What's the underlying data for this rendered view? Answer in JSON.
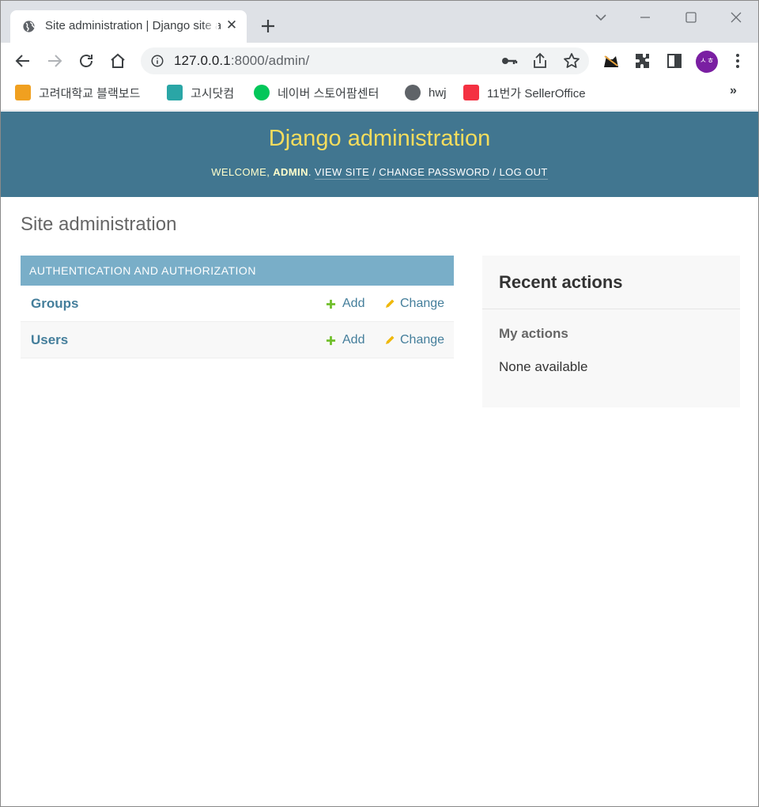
{
  "browser": {
    "tab_title": "Site administration | Django site admin",
    "tab_close": "✕",
    "url_host": "127.0.0.1",
    "url_rest": ":8000/admin/",
    "avatar_text": "ㅅㅎ"
  },
  "bookmarks": [
    {
      "label": "고려대학교 블랙보드",
      "icon": "pencil-icon",
      "color": "#f0a020"
    },
    {
      "label": "고시닷컴",
      "icon": "g-icon",
      "color": "#2aa6a6"
    },
    {
      "label": "네이버 스토어팜센터",
      "icon": "store-icon",
      "color": "#03c75a"
    },
    {
      "label": "hwj",
      "icon": "globe-icon",
      "color": "#5f6368"
    },
    {
      "label": "11번가 SellerOffice",
      "icon": "11st-icon",
      "color": "#f43142"
    }
  ],
  "bookmarks_more": "»",
  "django": {
    "branding": "Django administration",
    "welcome": "Welcome,",
    "user": "admin",
    "view_site": "View site",
    "change_password": "Change password",
    "log_out": "Log out",
    "separator": "/",
    "header_bg": "#417690",
    "branding_color": "#f5dd5d"
  },
  "page": {
    "title": "Site administration",
    "module_caption": "Authentication and Authorization",
    "models": [
      {
        "name": "Groups",
        "add": "Add",
        "change": "Change"
      },
      {
        "name": "Users",
        "add": "Add",
        "change": "Change"
      }
    ]
  },
  "recent": {
    "title": "Recent actions",
    "subtitle": "My actions",
    "empty": "None available"
  }
}
